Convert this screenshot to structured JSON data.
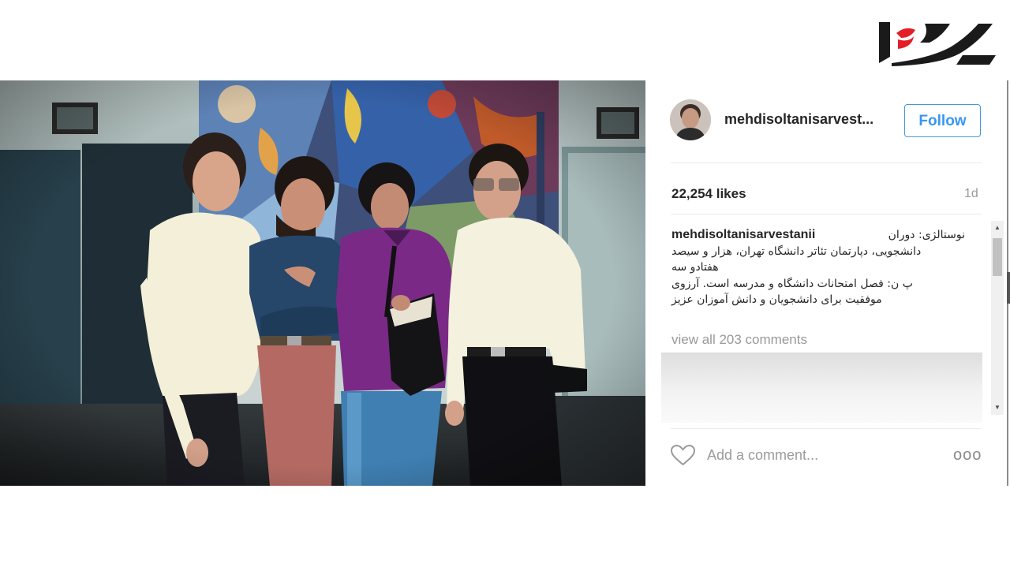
{
  "brand": {
    "logo_icon": "site-logo-icon",
    "accent_red": "#e41e26",
    "logo_dark": "#1a1a1a"
  },
  "post": {
    "photo_icon": "vintage-group-photo",
    "username": "mehdisoltanisarvest...",
    "follow_label": "Follow",
    "likes": "22,254 likes",
    "time_ago": "1d",
    "caption_user": "mehdisoltanisarvestanii",
    "caption_line1": "نوستالژی: دوران",
    "caption_line2": "دانشجویی، دپارتمان تئاتر دانشگاه تهران، هزار و سیصد",
    "caption_line3": "هفتادو سه",
    "caption_line4": "پ ن: فصل امتحانات دانشگاه و مدرسه است. آرزوی",
    "caption_line5": "موفقیت برای دانشجویان و دانش آموزان عزیز",
    "view_comments": "view all 203 comments",
    "comment_placeholder": "Add a comment...",
    "more_glyph": "ooo",
    "link_color": "#3897f0"
  }
}
